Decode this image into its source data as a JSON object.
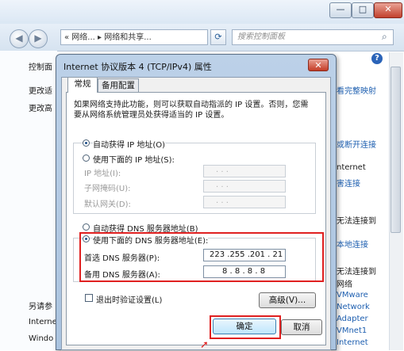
{
  "explorer": {
    "address_text": "« 网络... ▸ 网络和共享...",
    "search_placeholder": "搜索控制面板",
    "left_items": [
      "控制面",
      "更改适",
      "更改高",
      "另请参",
      "Interne",
      "Windo"
    ],
    "right_items": [
      {
        "text": "看完整映射",
        "color": "blue"
      },
      {
        "text": "或断开连接",
        "color": "blue"
      },
      {
        "text": "nternet",
        "color": "dark"
      },
      {
        "text": "害连接",
        "color": "blue"
      },
      {
        "text": "无法连接到",
        "color": "dark"
      },
      {
        "text": "本地连接",
        "color": "blue"
      },
      {
        "text": "无法连接到",
        "color": "dark"
      },
      {
        "text": "网络",
        "color": "dark"
      },
      {
        "text": "VMware",
        "color": "blue"
      },
      {
        "text": "Network",
        "color": "blue"
      },
      {
        "text": "Adapter",
        "color": "blue"
      },
      {
        "text": "VMnet1",
        "color": "blue"
      },
      {
        "text": "Internet",
        "color": "blue"
      }
    ],
    "window_buttons": [
      "—",
      "□",
      "✕"
    ]
  },
  "dialog": {
    "title": "Internet 协议版本 4 (TCP/IPv4) 属性",
    "close_label": "✕",
    "tabs": [
      "常规",
      "备用配置"
    ],
    "description": "如果网络支持此功能，则可以获取自动指派的 IP 设置。否则，您需要从网络系统管理员处获得适当的 IP 设置。",
    "ip_auto_label": "自动获得 IP 地址(O)",
    "ip_manual_label": "使用下面的 IP 地址(S):",
    "ip_fields": [
      {
        "label": "IP 地址(I):",
        "value": ".      .      ."
      },
      {
        "label": "子网掩码(U):",
        "value": ".      .      ."
      },
      {
        "label": "默认网关(D):",
        "value": ".      .      ."
      }
    ],
    "dns_auto_label": "自动获得 DNS 服务器地址(B)",
    "dns_manual_label": "使用下面的 DNS 服务器地址(E):",
    "dns_fields": [
      {
        "label": "首选 DNS 服务器(P):",
        "value": "223 .255 .201 . 21"
      },
      {
        "label": "备用 DNS 服务器(A):",
        "value": "8 .  8 .  8 .  8"
      }
    ],
    "validate_label": "退出时验证设置(L)",
    "advanced_label": "高级(V)...",
    "ok_label": "确定",
    "cancel_label": "取消"
  },
  "colors": {
    "highlight": "#e02020",
    "link": "#1e5fb0"
  }
}
